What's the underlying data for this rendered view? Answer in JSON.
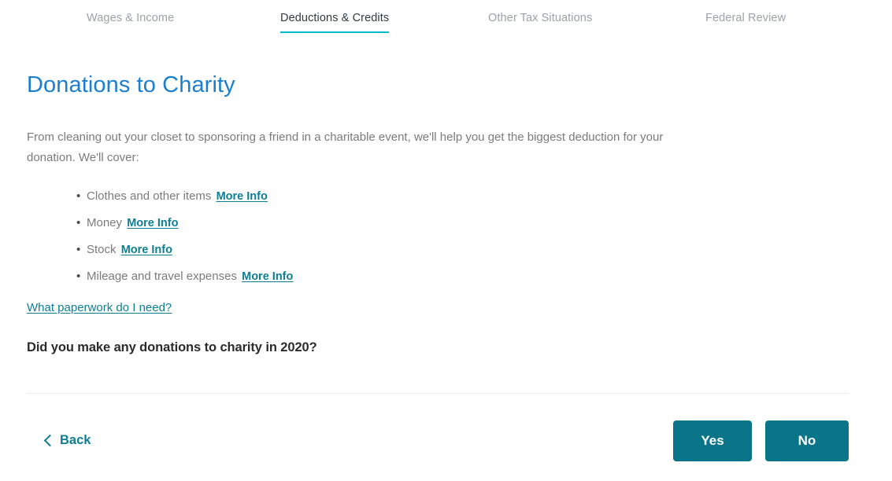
{
  "nav": {
    "tabs": [
      {
        "label": "Wages & Income",
        "active": false
      },
      {
        "label": "Deductions & Credits",
        "active": true
      },
      {
        "label": "Other Tax Situations",
        "active": false
      },
      {
        "label": "Federal Review",
        "active": false
      }
    ]
  },
  "main": {
    "title": "Donations to Charity",
    "intro": "From cleaning out your closet to sponsoring a friend in a charitable event, we'll help you get the biggest deduction for your donation. We'll cover:",
    "items": [
      {
        "text": "Clothes and other items",
        "link": "More Info"
      },
      {
        "text": "Money",
        "link": "More Info"
      },
      {
        "text": "Stock",
        "link": "More Info"
      },
      {
        "text": "Mileage and travel expenses",
        "link": "More Info"
      }
    ],
    "paperwork_link": "What paperwork do I need?",
    "question": "Did you make any donations to charity in 2020?"
  },
  "footer": {
    "back_label": "Back",
    "back_icon": "chevron-left-icon",
    "yes_label": "Yes",
    "no_label": "No"
  },
  "colors": {
    "accent_teal": "#0a7589",
    "link_teal": "#0c7f92",
    "tab_underline": "#00b9cc",
    "title_blue": "#1b7fd0",
    "body_gray": "#7b7b7b",
    "inactive_tab": "#9aa2ab",
    "divider": "#ececec"
  }
}
